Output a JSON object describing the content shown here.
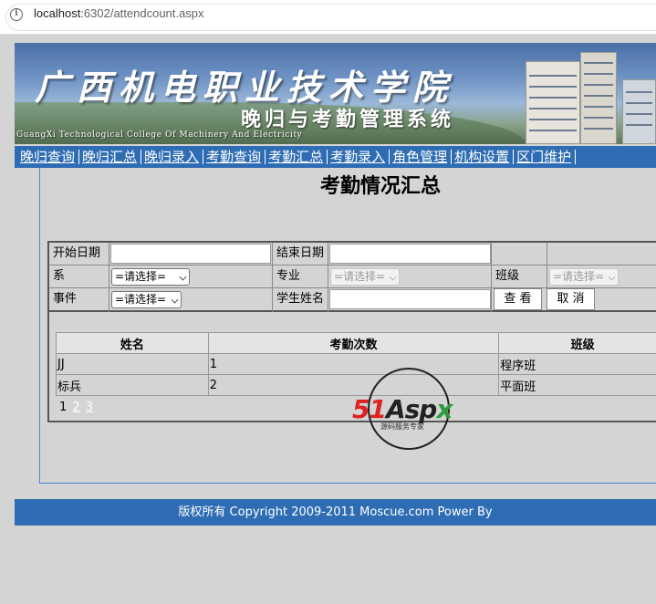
{
  "browser": {
    "url_host": "localhost",
    "url_rest": ":6302/attendcount.aspx",
    "info_icon": "info-icon"
  },
  "banner": {
    "title": "广西机电职业技术学院",
    "subtitle": "晚归与考勤管理系统",
    "english": "GuangXi Technological College Of Machinery And Electricity"
  },
  "nav": {
    "items": [
      "晚归查询",
      "晚归汇总",
      "晚归录入",
      "考勤查询",
      "考勤汇总",
      "考勤录入",
      "角色管理",
      "机构设置",
      "区门维护"
    ]
  },
  "page": {
    "title": "考勤情况汇总"
  },
  "search": {
    "start_date_label": "开始日期",
    "start_date_value": "",
    "end_date_label": "结束日期",
    "end_date_value": "",
    "dept_label": "系",
    "dept_value": "=请选择=",
    "major_label": "专业",
    "major_value": "=请选择=",
    "class_label": "班级",
    "class_value": "=请选择=",
    "event_label": "事件",
    "event_value": "=请选择=",
    "student_label": "学生姓名",
    "student_value": "",
    "view_button": "查 看",
    "cancel_button": "取 消"
  },
  "table": {
    "headers": [
      "姓名",
      "考勤次数",
      "班级"
    ],
    "rows": [
      [
        "JJ",
        "1",
        "程序班"
      ],
      [
        "标兵",
        "2",
        "平面班"
      ]
    ]
  },
  "pager": {
    "current": "1",
    "pages": [
      "2",
      "3"
    ]
  },
  "watermark": {
    "brand_a": "51",
    "brand_b": "Asp",
    "brand_c": "x",
    "tagline": "源码服务专家"
  },
  "footer": {
    "text": "版权所有 Copyright 2009-2011 Moscue.com Power By"
  }
}
